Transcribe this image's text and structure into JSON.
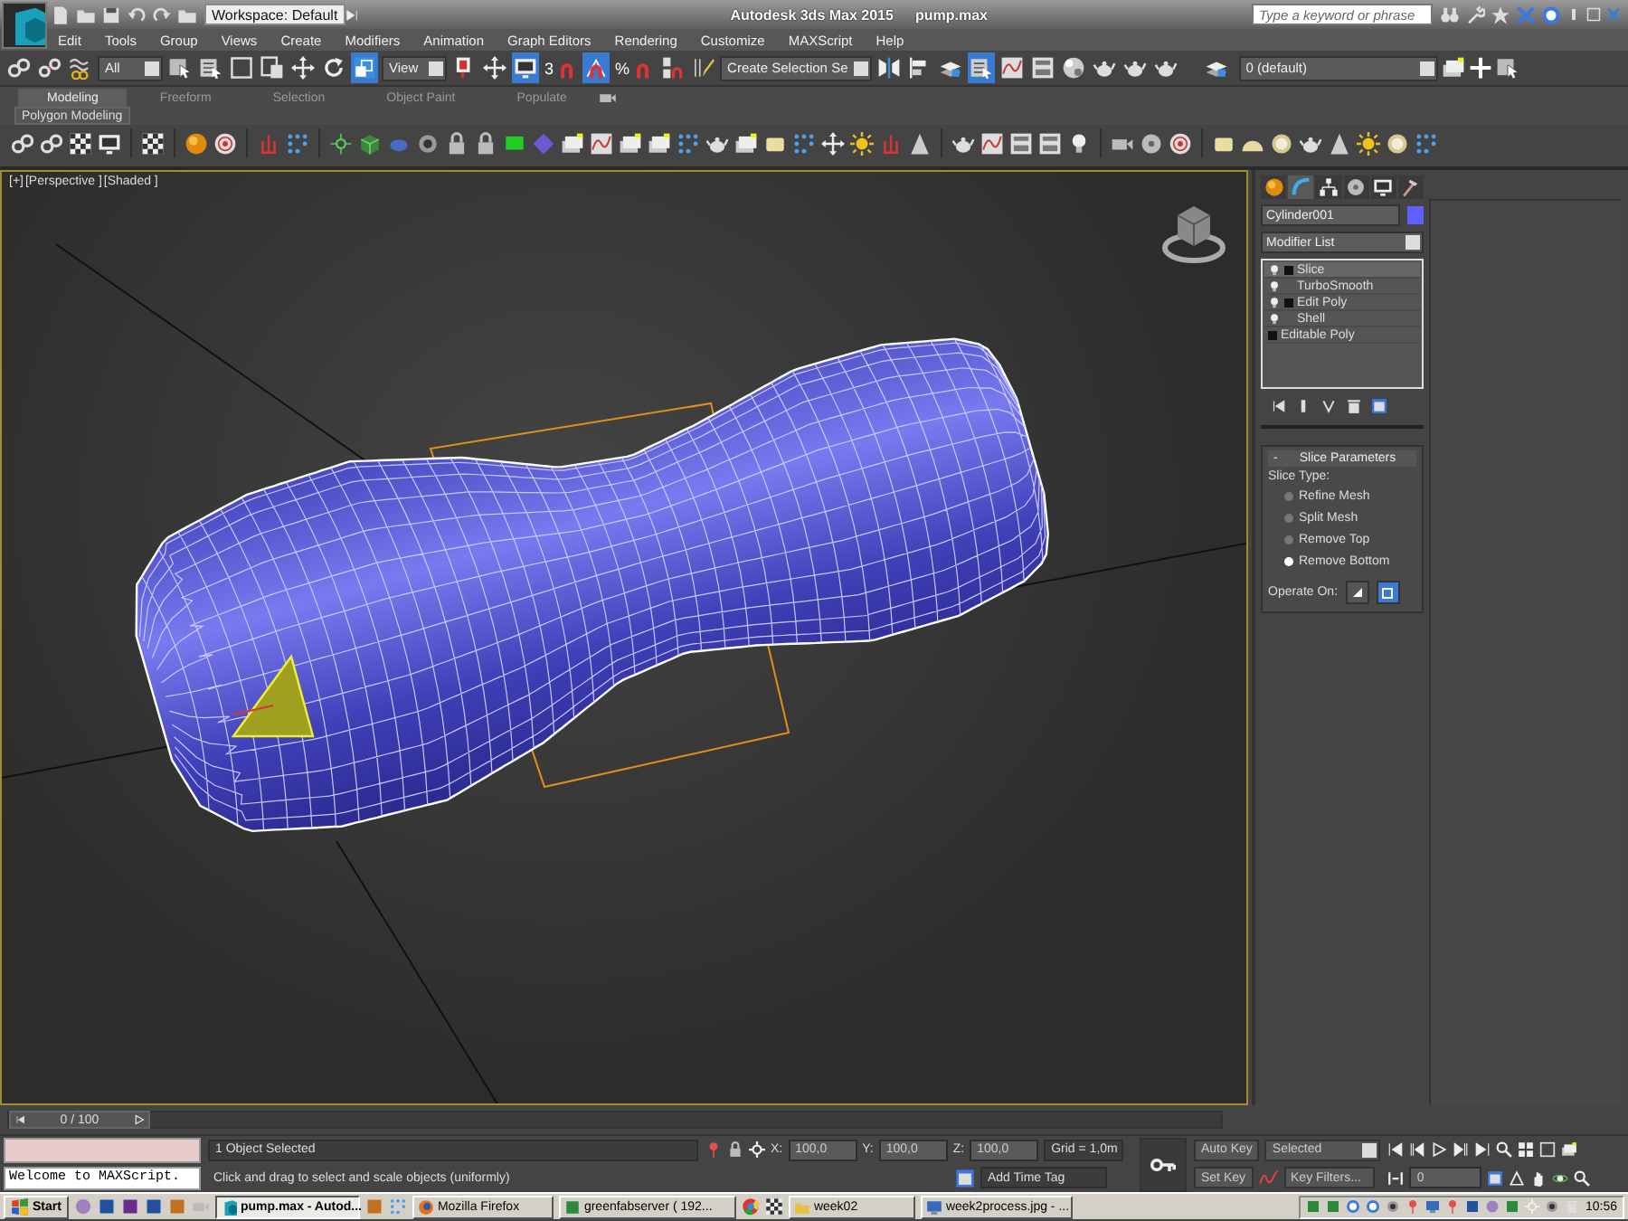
{
  "title_bar": {
    "workspace": "Workspace: Default",
    "app_title": "Autodesk 3ds Max 2015",
    "file_name": "pump.max",
    "search": {
      "placeholder": "Type a keyword or phrase"
    }
  },
  "menu_bar": [
    "Edit",
    "Tools",
    "Group",
    "Views",
    "Create",
    "Modifiers",
    "Animation",
    "Graph Editors",
    "Rendering",
    "Customize",
    "MAXScript",
    "Help"
  ],
  "main_toolbar": {
    "tools": [
      {
        "kind": "link",
        "selected": false
      },
      {
        "kind": "unlink",
        "selected": false
      },
      {
        "kind": "bind",
        "selected": false
      },
      {
        "kind": "dropdown",
        "value": "All"
      },
      {
        "kind": "select",
        "selected": false
      },
      {
        "kind": "select_by_name",
        "selected": false
      },
      {
        "kind": "region",
        "selected": false
      },
      {
        "kind": "window_crossing",
        "selected": false
      },
      {
        "kind": "move",
        "selected": false
      },
      {
        "kind": "rotate",
        "selected": false
      },
      {
        "kind": "scale",
        "selected": true
      },
      {
        "kind": "dropdown",
        "value": "View"
      },
      {
        "kind": "pivot",
        "selected": false
      },
      {
        "kind": "manipulate",
        "selected": false
      },
      {
        "kind": "keyboard_override",
        "selected": true
      },
      {
        "kind": "snap",
        "label": "3",
        "selected": false
      },
      {
        "kind": "angle_snap",
        "selected": true
      },
      {
        "kind": "percent_snap",
        "label": "%",
        "selected": false
      },
      {
        "kind": "spinner_snap",
        "selected": false
      },
      {
        "kind": "edit_named",
        "selected": false
      },
      {
        "kind": "dropdown",
        "value": "Create Selection Se"
      },
      {
        "kind": "mirror",
        "selected": false
      },
      {
        "kind": "align",
        "selected": false
      },
      {
        "kind": "layer_manager",
        "selected": false
      },
      {
        "kind": "scene_explorer",
        "selected": true
      },
      {
        "kind": "curve_editor",
        "selected": false
      },
      {
        "kind": "schematic",
        "selected": false
      },
      {
        "kind": "material_editor",
        "selected": false
      },
      {
        "kind": "render_setup",
        "selected": false
      },
      {
        "kind": "render_frame",
        "selected": false
      },
      {
        "kind": "render",
        "selected": false
      }
    ],
    "layer": "0 (default)"
  },
  "ribbon": {
    "tabs": [
      {
        "label": "Modeling",
        "selected": true
      },
      {
        "label": "Freeform",
        "selected": false
      },
      {
        "label": "Selection",
        "selected": false
      },
      {
        "label": "Object Paint",
        "selected": false
      },
      {
        "label": "Populate",
        "selected": false
      }
    ],
    "panel": "Polygon Modeling"
  },
  "viewport": {
    "labels": [
      "[+]",
      "[Perspective ]",
      "[Shaded ]"
    ]
  },
  "command_panel": {
    "tabs": [
      {
        "kind": "create",
        "selected": false
      },
      {
        "kind": "modify",
        "selected": true
      },
      {
        "kind": "hierarchy",
        "selected": false
      },
      {
        "kind": "motion",
        "selected": false
      },
      {
        "kind": "display",
        "selected": false
      },
      {
        "kind": "utilities",
        "selected": false
      }
    ],
    "object_name": "Cylinder001",
    "modifier_list": "Modifier List",
    "stack": [
      {
        "label": "Slice",
        "kind": "modifier",
        "expandable": true,
        "selected": true
      },
      {
        "label": "TurboSmooth",
        "kind": "modifier",
        "expandable": false,
        "selected": false
      },
      {
        "label": "Edit Poly",
        "kind": "modifier",
        "expandable": true,
        "selected": false
      },
      {
        "label": "Shell",
        "kind": "modifier",
        "expandable": false,
        "selected": false
      },
      {
        "label": "Editable Poly",
        "kind": "base",
        "expandable": true,
        "selected": false
      }
    ],
    "rollout": {
      "collapse": "-",
      "title": "Slice Parameters",
      "slice_type_label": "Slice Type:",
      "options": [
        {
          "label": "Refine Mesh",
          "selected": false
        },
        {
          "label": "Split Mesh",
          "selected": false
        },
        {
          "label": "Remove Top",
          "selected": false
        },
        {
          "label": "Remove Bottom",
          "selected": true
        }
      ],
      "operate_on_label": "Operate On:",
      "operate_on": [
        {
          "kind": "faces",
          "selected": false
        },
        {
          "kind": "polygons",
          "selected": true
        }
      ]
    }
  },
  "time_slider": {
    "label": "0 / 100",
    "level": 0
  },
  "status": {
    "listener_output": "Welcome to MAXScript.",
    "selection": "1 Object Selected",
    "prompt": "Click and drag to select and scale objects (uniformly)",
    "coords": [
      {
        "label": "X:",
        "value": "100,0"
      },
      {
        "label": "Y:",
        "value": "100,0"
      },
      {
        "label": "Z:",
        "value": "100,0"
      }
    ],
    "grid": "Grid = 1,0m",
    "add_time_tag": "Add Time Tag"
  },
  "animation": {
    "auto_key": "Auto Key",
    "key_mode": "Selected",
    "set_key": "Set Key",
    "key_filters": "Key Filters...",
    "frame": "0"
  },
  "taskbar": {
    "start": "Start",
    "tasks": [
      {
        "label": "pump.max - Autod...",
        "selected": true
      },
      {
        "label": "Mozilla Firefox",
        "selected": false
      },
      {
        "label": "greenfabserver ( 192...",
        "selected": false
      },
      {
        "label": "week02",
        "selected": false
      },
      {
        "label": "week2process.jpg - ...",
        "selected": false
      }
    ],
    "clock": "10:56"
  }
}
